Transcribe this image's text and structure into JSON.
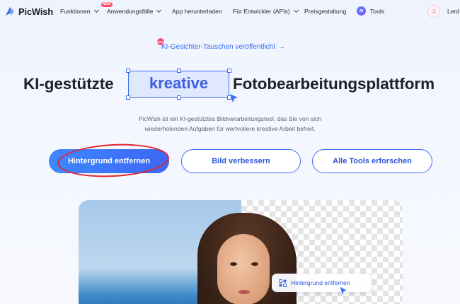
{
  "nav": {
    "logo": "PicWish",
    "items": [
      {
        "label": "Funktionen",
        "chevron": true
      },
      {
        "label": "Anwendungsfälle",
        "chevron": true,
        "badge": "NEW"
      },
      {
        "label": "App herunterladen",
        "chevron": false
      },
      {
        "label": "Für Entwickler (APIs)",
        "chevron": true
      },
      {
        "label": "Preisgestaltung",
        "chevron": false
      },
      {
        "label": "Tools",
        "chevron": false,
        "badge": "AI"
      }
    ],
    "login": "Lerd"
  },
  "announcement": {
    "badge": "NEW",
    "text": "KI-Gesichter-Tauschen veröffentlicht",
    "arrow": "→"
  },
  "headline": {
    "left": "KI-gestützte",
    "highlight": "kreative",
    "right": "Fotobearbeitungsplattform"
  },
  "subtitle": {
    "line1": "PicWish ist ein KI-gestütztes Bildverarbeitungstool, das Sie von sich",
    "line2": "wiederholenden Aufgaben für wertvollere kreative Arbeit befreit."
  },
  "buttons": {
    "primary": "Hintergrund entfernen",
    "enhance": "Bild verbessern",
    "explore": "Alle Tools erforschen"
  },
  "hero": {
    "tooltip": "Hintergrund entfernen"
  },
  "colors": {
    "accent": "#3d6df5",
    "highlight_bg": "#dfe8fd",
    "annotation": "#e0262f"
  },
  "icons": [
    "picwish-logo-icon",
    "chevron-down-icon",
    "avatar-icon",
    "cursor-icon",
    "remove-bg-icon"
  ]
}
